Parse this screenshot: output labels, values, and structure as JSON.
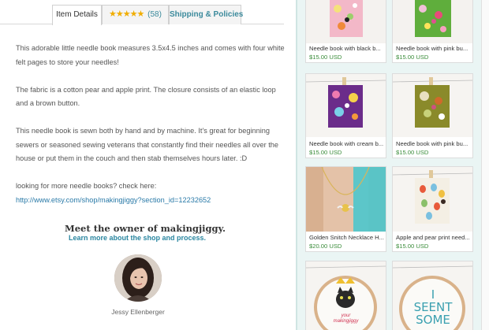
{
  "tabs": {
    "details": "Item Details",
    "stars": "★★★★★",
    "reviews_count": "(58)",
    "shipping": "Shipping & Policies"
  },
  "description": {
    "p1": "This adorable little needle book measures 3.5x4.5 inches and comes with four white felt pages to store your needles!",
    "p2": "The fabric is a cotton pear and apple print. The closure consists of an elastic loop and a brown button.",
    "p3": "This needle book is sewn both by hand and by machine. It's great for beginning sewers or seasoned sewing veterans that constantly find their needles all over the house or put them in the couch and then stab themselves hours later. :D",
    "p4_text": "looking for more needle books? check here:",
    "p4_link": "http://www.etsy.com/shop/makingjiggy?section_id=12232652"
  },
  "owner": {
    "title": "Meet the owner of makingjiggy.",
    "link": "Learn more about the shop and process.",
    "name": "Jessy Ellenberger"
  },
  "listings": [
    {
      "title": "Needle book with black b...",
      "price": "$15.00 USD"
    },
    {
      "title": "Needle book with pink bu...",
      "price": "$15.00 USD"
    },
    {
      "title": "Needle book with cream b...",
      "price": "$15.00 USD"
    },
    {
      "title": "Needle book with pink bu...",
      "price": "$15.00 USD"
    },
    {
      "title": "Golden Snitch Necklace H...",
      "price": "$20.00 USD"
    },
    {
      "title": "Apple and pear print need...",
      "price": "$15.00 USD"
    },
    {
      "title": "",
      "price": ""
    },
    {
      "title": "",
      "price": ""
    }
  ],
  "hoop_text": {
    "cat": "your makingjiggy",
    "sent": "I SEENT SOME"
  },
  "colors": {
    "link": "#2a7aa8",
    "price": "#3a8c3a",
    "star": "#f0ad00",
    "panel": "#eaf5f4"
  }
}
